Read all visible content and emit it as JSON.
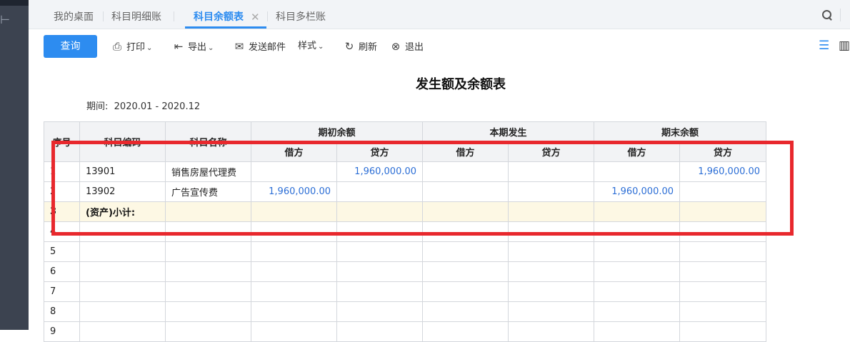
{
  "tabs": [
    {
      "label": "我的桌面"
    },
    {
      "label": "科目明细账"
    },
    {
      "label": "科目余额表"
    },
    {
      "label": "科目多栏账"
    }
  ],
  "toolbar": {
    "query": "查询",
    "print": "打印",
    "export": "导出",
    "send_mail": "发送邮件",
    "style": "样式",
    "refresh": "刷新",
    "exit": "退出"
  },
  "report": {
    "title": "发生额及余额表",
    "period_label": "期间:",
    "period_value": "2020.01 - 2020.12"
  },
  "table": {
    "headers": {
      "seq": "序号",
      "code": "科目编码",
      "name": "科目名称",
      "opening": "期初余额",
      "current": "本期发生",
      "closing": "期末余额",
      "debit": "借方",
      "credit": "贷方"
    },
    "rows": [
      {
        "seq": "1",
        "code": "13901",
        "name": "销售房屋代理费",
        "open_debit": "",
        "open_credit": "1,960,000.00",
        "cur_debit": "",
        "cur_credit": "",
        "close_debit": "",
        "close_credit": "1,960,000.00"
      },
      {
        "seq": "2",
        "code": "13902",
        "name": "广告宣传费",
        "open_debit": "1,960,000.00",
        "open_credit": "",
        "cur_debit": "",
        "cur_credit": "",
        "close_debit": "1,960,000.00",
        "close_credit": ""
      },
      {
        "seq": "3",
        "code": "(资产)小计:",
        "name": "",
        "open_debit": "",
        "open_credit": "",
        "cur_debit": "",
        "cur_credit": "",
        "close_debit": "",
        "close_credit": ""
      },
      {
        "seq": "4",
        "code": "",
        "name": "",
        "open_debit": "",
        "open_credit": "",
        "cur_debit": "",
        "cur_credit": "",
        "close_debit": "",
        "close_credit": ""
      },
      {
        "seq": "5",
        "code": "",
        "name": "",
        "open_debit": "",
        "open_credit": "",
        "cur_debit": "",
        "cur_credit": "",
        "close_debit": "",
        "close_credit": ""
      },
      {
        "seq": "6",
        "code": "",
        "name": "",
        "open_debit": "",
        "open_credit": "",
        "cur_debit": "",
        "cur_credit": "",
        "close_debit": "",
        "close_credit": ""
      },
      {
        "seq": "7",
        "code": "",
        "name": "",
        "open_debit": "",
        "open_credit": "",
        "cur_debit": "",
        "cur_credit": "",
        "close_debit": "",
        "close_credit": ""
      },
      {
        "seq": "8",
        "code": "",
        "name": "",
        "open_debit": "",
        "open_credit": "",
        "cur_debit": "",
        "cur_credit": "",
        "close_debit": "",
        "close_credit": ""
      },
      {
        "seq": "9",
        "code": "",
        "name": "",
        "open_debit": "",
        "open_credit": "",
        "cur_debit": "",
        "cur_credit": "",
        "close_debit": "",
        "close_credit": ""
      }
    ]
  },
  "colors": {
    "accent": "#2d8cf0",
    "highlight_box": "#e8282d",
    "subtotal_row": "#fdf8e4",
    "sidebar": "#3c4350"
  },
  "icons": [
    "search-icon",
    "list-view-icon",
    "chart-view-icon",
    "print-icon",
    "export-icon",
    "mail-icon",
    "refresh-icon",
    "close-circle-icon"
  ]
}
